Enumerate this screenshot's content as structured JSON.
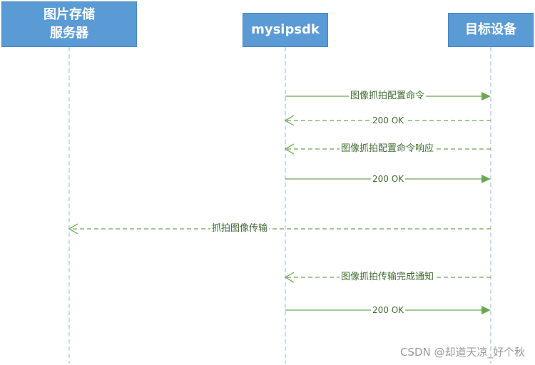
{
  "participants": [
    {
      "id": "storage",
      "name": "图片存储\n服务器"
    },
    {
      "id": "sdk",
      "name": "mysipsdk"
    },
    {
      "id": "device",
      "name": "目标设备"
    }
  ],
  "messages": [
    {
      "from": "sdk",
      "to": "device",
      "label": "图像抓拍配置命令",
      "style": "solid"
    },
    {
      "from": "device",
      "to": "sdk",
      "label": "200 OK",
      "style": "dashed"
    },
    {
      "from": "device",
      "to": "sdk",
      "label": "图像抓拍配置命令响应",
      "style": "dashed"
    },
    {
      "from": "sdk",
      "to": "device",
      "label": "200 OK",
      "style": "solid"
    },
    {
      "from": "device",
      "to": "storage",
      "label": "抓拍图像传输",
      "style": "dashed"
    },
    {
      "from": "device",
      "to": "sdk",
      "label": "图像抓拍传输完成通知",
      "style": "dashed"
    },
    {
      "from": "sdk",
      "to": "device",
      "label": "200 OK",
      "style": "solid"
    }
  ],
  "watermark": "CSDN @却道天凉_好个秋",
  "colors": {
    "participant_fill": "#5b9bd5",
    "lifeline": "#a9c8e8",
    "arrow": "#6aa84f",
    "label_text": "#3f6b2f"
  }
}
